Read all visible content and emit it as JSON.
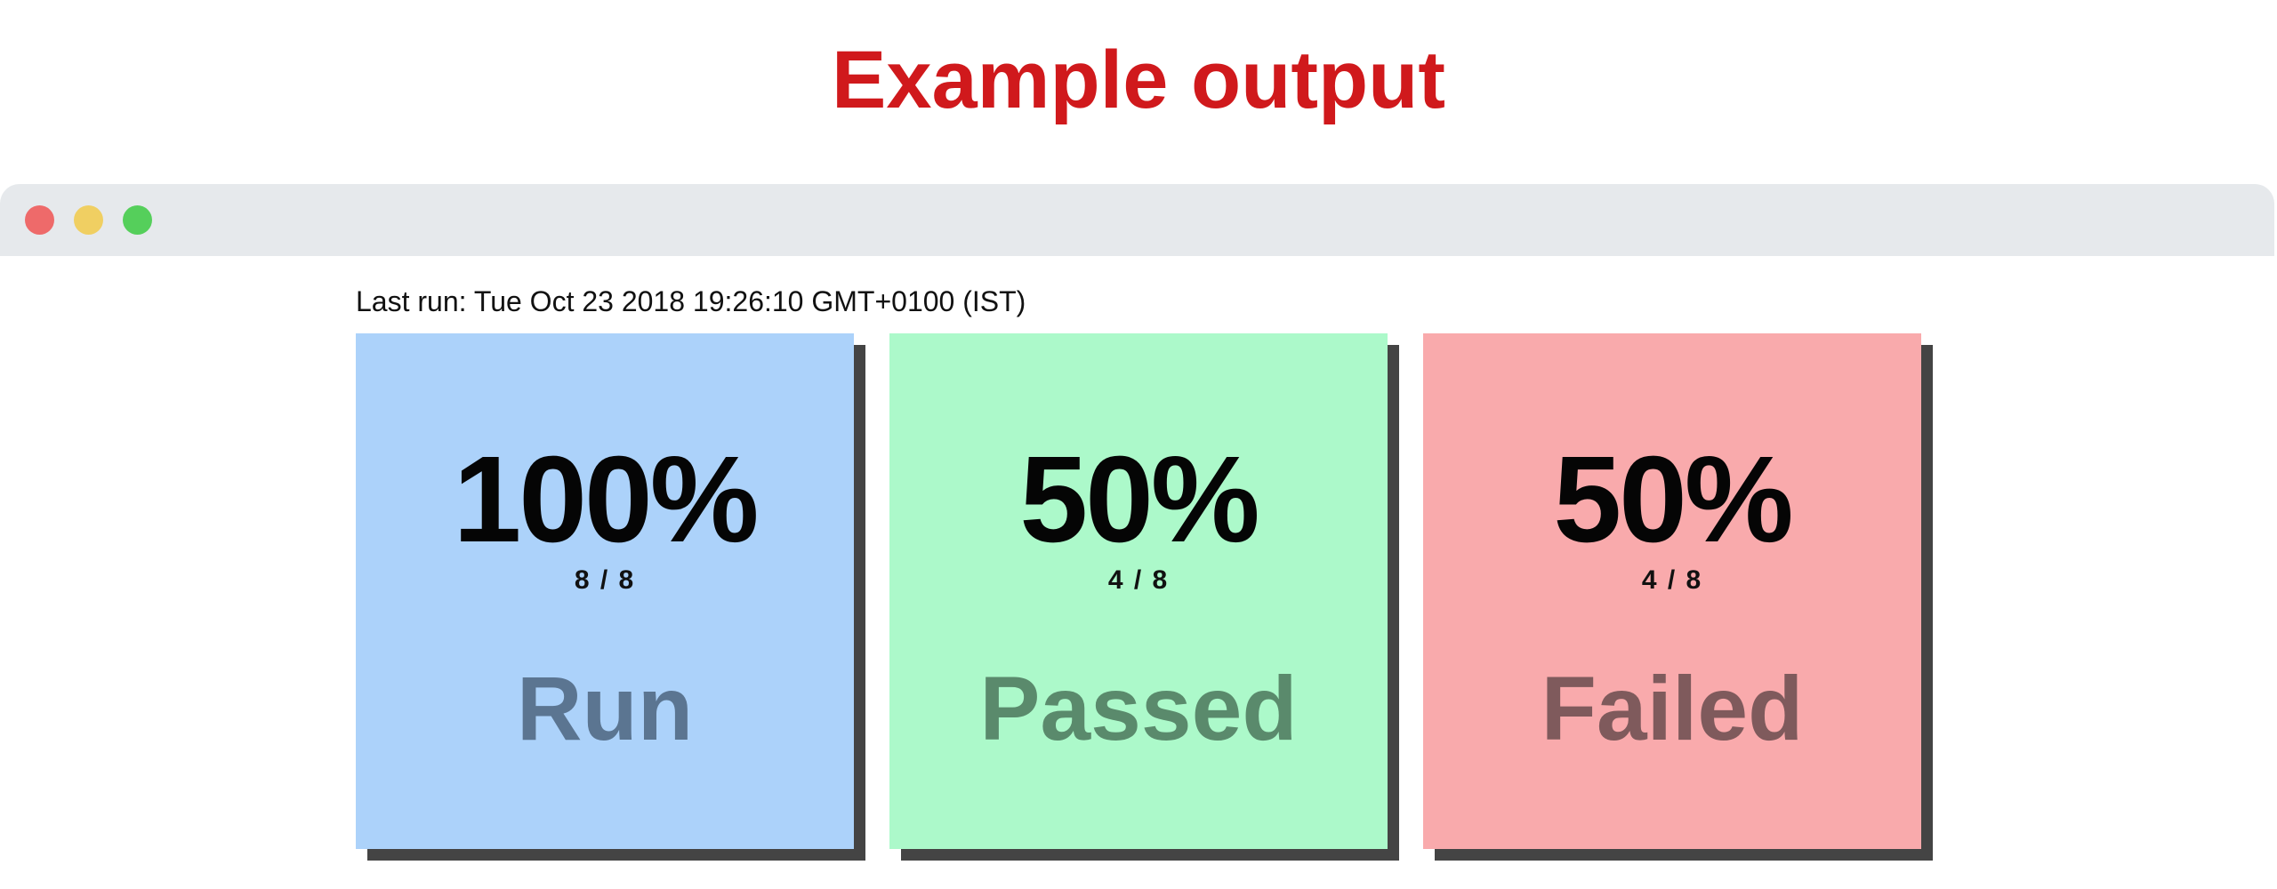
{
  "heading": "Example output",
  "window": {
    "buttons": [
      {
        "name": "close",
        "color": "#ee6a6a"
      },
      {
        "name": "minimize",
        "color": "#f0cf62"
      },
      {
        "name": "zoom",
        "color": "#55cf5b"
      }
    ]
  },
  "last_run": "Last run: Tue Oct 23 2018 19:26:10 GMT+0100 (IST)",
  "cards": [
    {
      "id": "run",
      "percent": "100%",
      "count": "8 / 8",
      "label": "Run",
      "bg_color": "#acd2fa",
      "label_color": "#5b7591"
    },
    {
      "id": "passed",
      "percent": "50%",
      "count": "4 / 8",
      "label": "Passed",
      "bg_color": "#acf9ca",
      "label_color": "#5a8a6c"
    },
    {
      "id": "failed",
      "percent": "50%",
      "count": "4 / 8",
      "label": "Failed",
      "bg_color": "#f9aaac",
      "label_color": "#7f5a5c"
    }
  ]
}
